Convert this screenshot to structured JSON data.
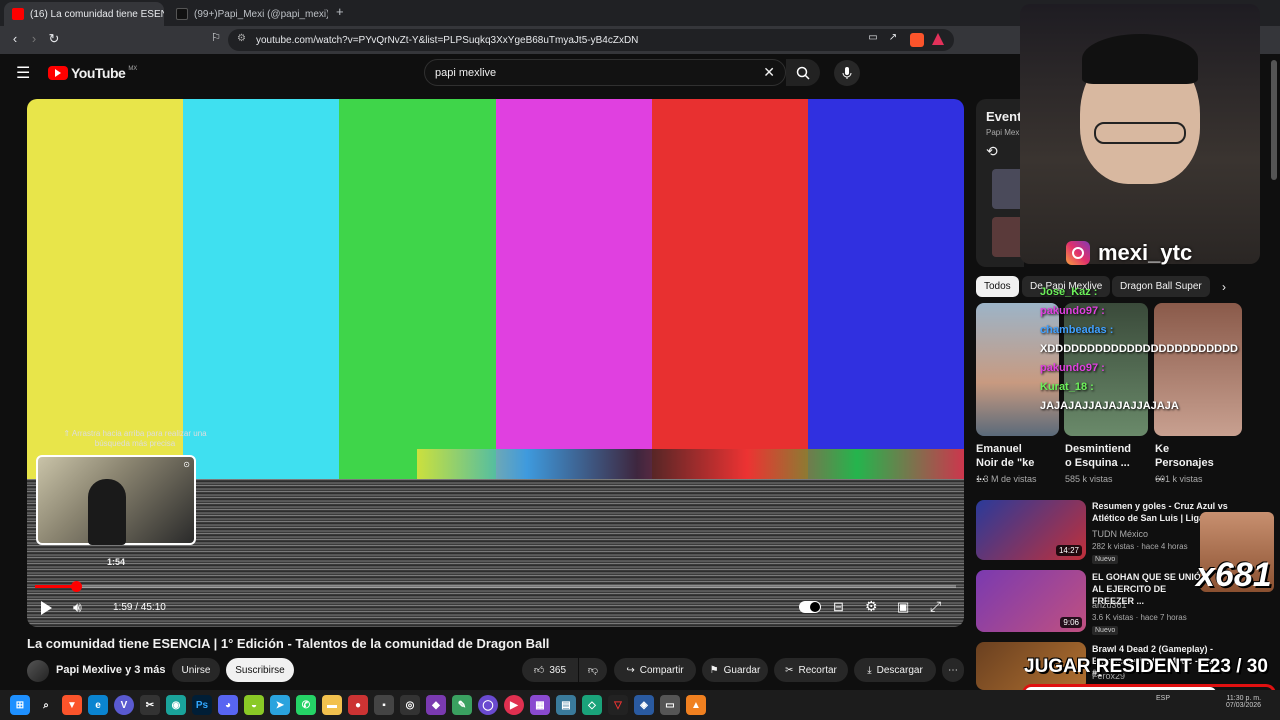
{
  "browser": {
    "tabs": [
      {
        "label": "(16) La comunidad tiene ESENCI",
        "close": "×"
      },
      {
        "label": "(99+)Papi_Mexi (@papi_mexi) | TikTo",
        "close": "×"
      }
    ],
    "new_tab": "+",
    "url": "youtube.com/watch?v=PYvQrNvZt-Y&list=PLPSuqkq3XxYgeB68uTmyaJt5-yB4cZxDN"
  },
  "youtube": {
    "logo": "YouTube",
    "region": "MX",
    "search_query": "papi mexlive"
  },
  "player": {
    "overlay_hint": "⇑ Arrastra hacia arriba para realizar una búsqueda más precisa",
    "preview_time": "1:54",
    "current_time": "1:59 / 45:10",
    "progress": 0.044,
    "colors": [
      "#e8e54a",
      "#3fe0f0",
      "#3fd54a",
      "#e040e0",
      "#e83030",
      "#3030e0"
    ]
  },
  "video": {
    "title": "La comunidad tiene ESENCIA | 1° Edición - Talentos de la comunidad de Dragon Ball",
    "channel": "Papi Mexlive y 3 más",
    "join": "Unirse",
    "subscribe": "Suscribirse",
    "likes": "365",
    "share": "Compartir",
    "save": "Guardar",
    "clip": "Recortar",
    "download": "Descargar"
  },
  "sidebar": {
    "playlist_title": "Event",
    "playlist_sub": "Papi Mex",
    "chips": [
      "Todos",
      "De Papi Mexlive",
      "Dragon Ball Super"
    ],
    "shorts": [
      {
        "title": "Emanuel Noir de \"ke ...",
        "views": "1.3 M de vistas"
      },
      {
        "title": "Desmintiend o Esquina ...",
        "views": "585 k vistas"
      },
      {
        "title": "Ke Personajes ...",
        "views": "601 k vistas"
      }
    ],
    "videos": [
      {
        "title": "Resumen y goles - Cruz Azul vs Atlético de San Luis | Liga",
        "channel": "TUDN México",
        "meta": "282 k vistas · hace 4 horas",
        "badge": "Nuevo",
        "duration": "14:27"
      },
      {
        "title": "EL GOHAN QUE SE UNIÓ AL EJERCITO DE FREEZER ...",
        "channel": "anzu361",
        "meta": "3.6 K vistas · hace 7 horas",
        "badge": "Nuevo",
        "duration": "9:06"
      },
      {
        "title": "Brawl 4 Dead 2 (Gameplay) - Entretenimiento - Modo - Part #1",
        "channel": "Ferox29",
        "meta": "",
        "badge": "",
        "duration": ""
      }
    ]
  },
  "stream": {
    "instagram": "mexi_ytc",
    "chat": [
      {
        "user": "Jose_Kaz :",
        "msg": ""
      },
      {
        "user": "pakundo97 :",
        "msg": ""
      },
      {
        "user": "chambeadas :",
        "msg": "XDDDDDDDDDDDDDDDDDDDDDDDD"
      },
      {
        "user": "pakundo97 :",
        "msg": ""
      },
      {
        "user": "Kurat_18 :",
        "msg": "JAJAJAJJAJAJAJJAJAJA"
      }
    ],
    "combo": "x681",
    "banner": "JUGAR RESIDENT E23 / 30",
    "goal_progress": 0.77
  },
  "taskbar": {
    "time": "11:30 p. m.",
    "date": "07/03/2026",
    "lang": "ESP"
  }
}
